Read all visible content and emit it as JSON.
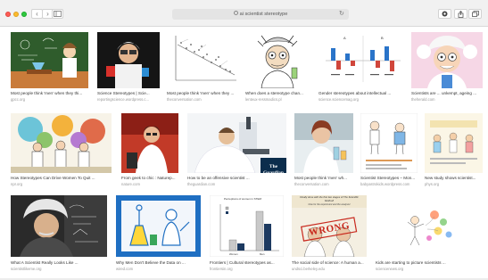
{
  "browser": {
    "address": "ai scientist stereotype",
    "back_label": "‹",
    "forward_label": "›",
    "reload_label": "↻"
  },
  "results": [
    {
      "caption": "Most people think 'men' when they thi...",
      "source": "gpcc.org"
    },
    {
      "caption": "Science Stereotypes | Scie...",
      "source": "reportingscience.wordpress.c..."
    },
    {
      "caption": "Most people think 'men' when they ...",
      "source": "theconversation.com"
    },
    {
      "caption": "When does a stereotype chan...",
      "source": "lenteux-ressmadics.pl"
    },
    {
      "caption": "Gender stereotypes about intellectual ...",
      "source": "science.sciencemag.org"
    },
    {
      "caption": "Scientists are ... unkempt, ageing ...",
      "source": "theherald.com"
    },
    {
      "caption": "How Stereotypes Can Drive Women To Quit ...",
      "source": "npr.org"
    },
    {
      "caption": "From geek to chic : Naturep...",
      "source": "nature.com"
    },
    {
      "caption": "How to be an offensive scientist ...",
      "source": "theguardian.com"
    },
    {
      "caption": "Most people think 'men' wh...",
      "source": "theconversation.com"
    },
    {
      "caption": "Scientist Stereotypes – Mon...",
      "source": "babyastrokids.wordpress.com"
    },
    {
      "caption": "New study shows scientist...",
      "source": "phys.org"
    },
    {
      "caption": "What A Scientist Really Looks Like ...",
      "source": "scientistlikeme.org"
    },
    {
      "caption": "Why Men Don't Believe the Data on ...",
      "source": "wired.com"
    },
    {
      "caption": "Frontiers | Cultural stereotypes as...",
      "source": "frontiersin.org"
    },
    {
      "caption": "The social side of science: A human a...",
      "source": "undsci.berkeley.edu"
    },
    {
      "caption": "Kids are starting to picture scientists ...",
      "source": "sciencenews.org"
    }
  ],
  "thumb_text": {
    "guardian": "The Guardian",
    "wrong": "WRONG",
    "chart5_title": "Perceptions of women in STEM",
    "chart5_labels": [
      "Women",
      "Men"
    ],
    "comic_title": "Finally done with the first two stages of The Scientific Method!",
    "comic_sub": "Now for the experiment and the analysis!"
  },
  "colors": {
    "chrome_bg": "#f1f1f1",
    "accent_blue": "#2a74c9",
    "accent_red": "#d0463b"
  }
}
